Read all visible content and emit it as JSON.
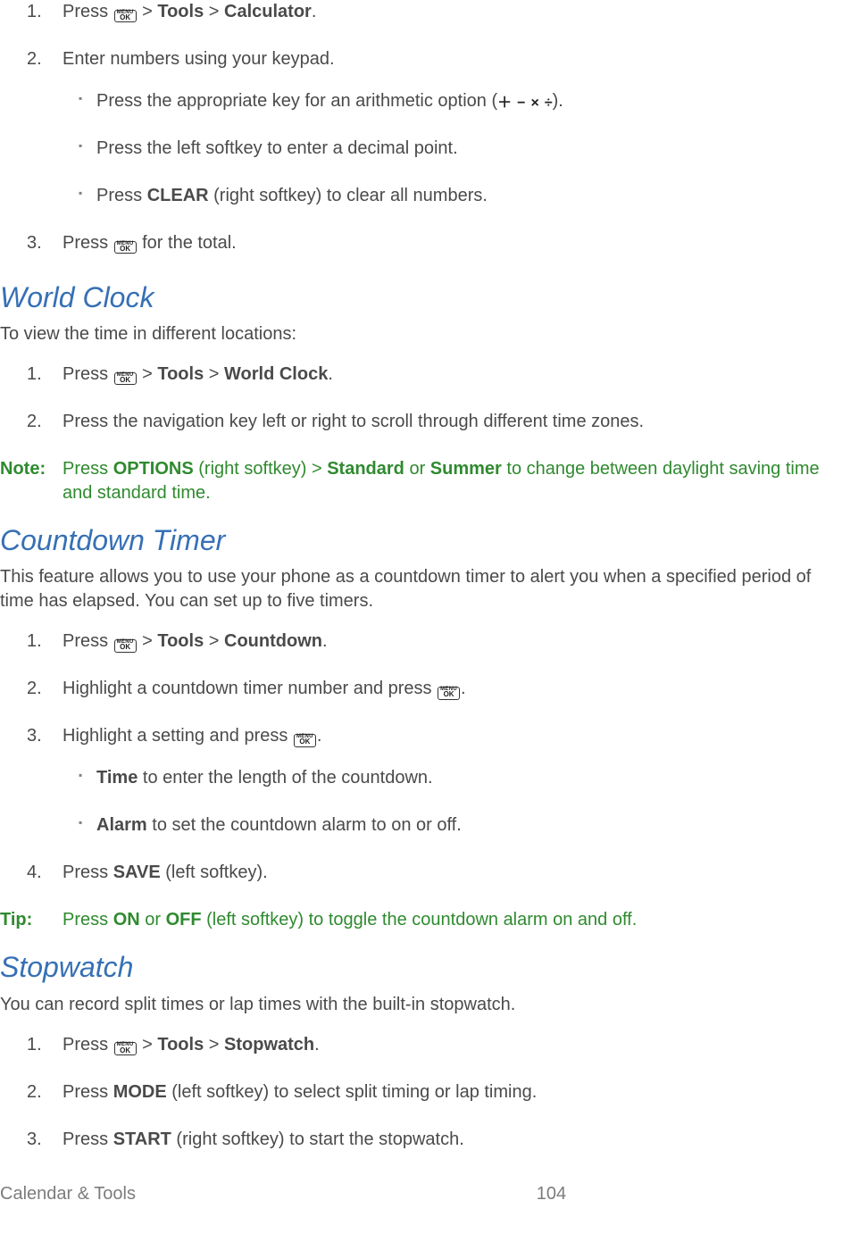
{
  "calc": {
    "s1_a": "Press ",
    "s1_b": " > ",
    "s1_tools": "Tools",
    "s1_c": " > ",
    "s1_target": "Calculator",
    "s1_d": ".",
    "s2": "Enter numbers using your keypad.",
    "s2_a": "Press the appropriate key for an arithmetic option (",
    "s2_a_end": ").",
    "s2_b": "Press the left softkey to enter a decimal point.",
    "s2_c_a": "Press ",
    "s2_c_key": "CLEAR",
    "s2_c_b": " (right softkey) to clear all numbers.",
    "s3_a": "Press ",
    "s3_b": " for the total."
  },
  "world": {
    "heading": "World Clock",
    "intro": "To view the time in different locations:",
    "s1_a": "Press ",
    "s1_b": " > ",
    "s1_tools": "Tools",
    "s1_c": " > ",
    "s1_target": "World Clock",
    "s1_d": ".",
    "s2": "Press the navigation key left or right to scroll through different time zones.",
    "note_label": "Note:",
    "note_a": "Press ",
    "note_key1": "OPTIONS",
    "note_b": " (right softkey) > ",
    "note_key2": "Standard",
    "note_c": " or ",
    "note_key3": "Summer",
    "note_d": " to change between daylight saving time and standard time."
  },
  "countdown": {
    "heading": "Countdown Timer",
    "intro": "This feature allows you to use your phone as a countdown timer to alert you when a specified period of time has elapsed. You can set up to five timers.",
    "s1_a": "Press ",
    "s1_b": " > ",
    "s1_tools": "Tools",
    "s1_c": " > ",
    "s1_target": "Countdown",
    "s1_d": ".",
    "s2_a": "Highlight a countdown timer number and press ",
    "s2_b": ".",
    "s3_a": "Highlight a setting and press ",
    "s3_b": ".",
    "s3_sub1_key": "Time",
    "s3_sub1_rest": " to enter the length of the countdown.",
    "s3_sub2_key": "Alarm",
    "s3_sub2_rest": " to set the countdown alarm to on or off.",
    "s4_a": "Press ",
    "s4_key": "SAVE",
    "s4_b": " (left softkey).",
    "tip_label": "Tip:",
    "tip_a": "Press ",
    "tip_key1": "ON",
    "tip_b": " or ",
    "tip_key2": "OFF",
    "tip_c": " (left softkey) to toggle the countdown alarm on and off."
  },
  "stopwatch": {
    "heading": "Stopwatch",
    "intro": "You can record split times or lap times with the built-in stopwatch.",
    "s1_a": "Press ",
    "s1_b": " > ",
    "s1_tools": "Tools",
    "s1_c": " > ",
    "s1_target": "Stopwatch",
    "s1_d": ".",
    "s2_a": "Press ",
    "s2_key": "MODE",
    "s2_b": " (left softkey) to select split timing or lap timing.",
    "s3_a": "Press ",
    "s3_key": "START",
    "s3_b": " (right softkey) to start the stopwatch."
  },
  "footer": {
    "title": "Calendar & Tools",
    "page": "104"
  },
  "icons": {
    "menu_top": "MENU",
    "menu_bottom": "OK",
    "op_plus": "＋",
    "op_minus": "−",
    "op_times": "×",
    "op_div": "÷"
  }
}
